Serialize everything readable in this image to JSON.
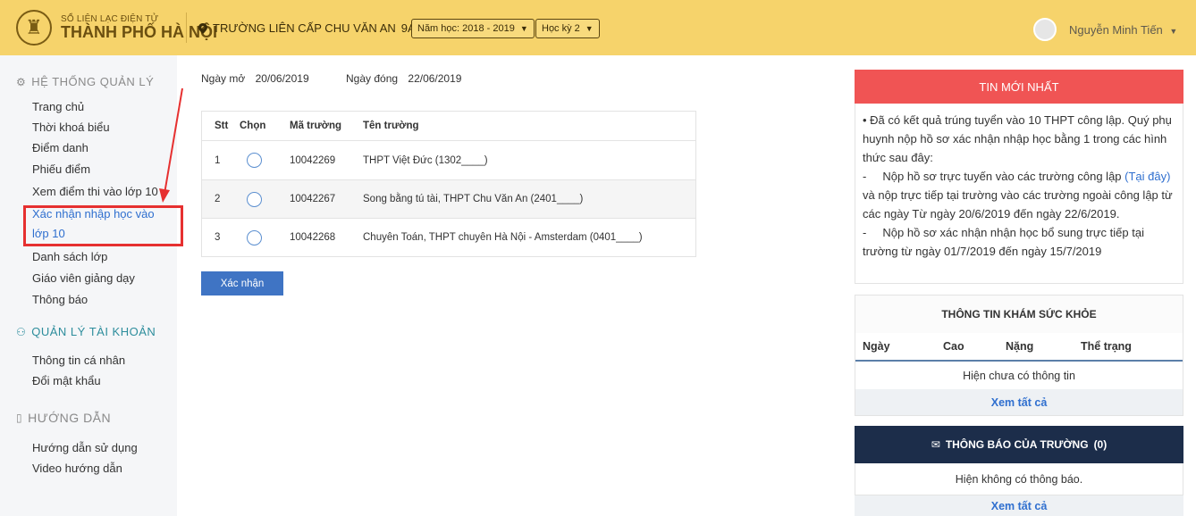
{
  "header": {
    "logo_small": "SỔ LIÊN LẠC ĐIỆN TỬ",
    "logo_big": "THÀNH PHỐ HÀ NỘI",
    "school": "TRƯỜNG LIÊN CẤP CHU VĂN AN",
    "class": "9A",
    "year_select": "Năm học: 2018 - 2019",
    "term_select": "Học kỳ 2",
    "user_name": "Nguyễn Minh Tiến"
  },
  "sidebar": {
    "section1": "HỆ THỐNG QUẢN LÝ",
    "items1": [
      "Trang chủ",
      "Thời khoá biểu",
      "Điểm danh",
      "Phiếu điểm",
      "Xem điểm thi vào lớp 10",
      "Xác nhận nhập học vào",
      "lớp 10",
      "Danh sách lớp",
      "Giáo viên giảng dạy",
      "Thông báo"
    ],
    "section2": "QUẢN LÝ TÀI KHOẢN",
    "items2": [
      "Thông tin cá nhân",
      "Đổi mật khẩu"
    ],
    "section3": "HƯỚNG DẪN",
    "items3": [
      "Hướng dẫn sử dụng",
      "Video hướng dẫn"
    ]
  },
  "main": {
    "open_label": "Ngày mở",
    "open_date": "20/06/2019",
    "close_label": "Ngày đóng",
    "close_date": "22/06/2019",
    "columns": [
      "Stt",
      "Chọn",
      "Mã trường",
      "Tên trường"
    ],
    "rows": [
      {
        "stt": "1",
        "code": "10042269",
        "name": "THPT Việt Đức (1302____)"
      },
      {
        "stt": "2",
        "code": "10042267",
        "name": "Song bằng tú tài, THPT Chu Văn An (2401____)"
      },
      {
        "stt": "3",
        "code": "10042268",
        "name": "Chuyên Toán, THPT chuyên Hà Nội - Amsterdam (0401____)"
      }
    ],
    "confirm_button": "Xác nhận"
  },
  "right": {
    "news_title": "TIN MỚI NHẤT",
    "news_p1": "• Đã có kết quả trúng tuyển vào 10 THPT công lập. Quý phụ huynh nộp hồ sơ xác nhận nhập học bằng 1 trong các hình thức sau đây:",
    "news_p2a": "-     Nộp hồ sơ trực tuyến vào các trường công lập ",
    "news_link": "(Tại đây)",
    "news_p2b": " và nộp trực tiếp tại trường vào các trường ngoài công lập từ các ngày Từ ngày 20/6/2019 đến ngày 22/6/2019.",
    "news_p3": "-     Nộp hồ sơ xác nhận nhận học bổ sung trực tiếp tại trường từ ngày 01/7/2019 đến ngày 15/7/2019",
    "health_title": "THÔNG TIN KHÁM SỨC KHỎE",
    "health_cols": [
      "Ngày",
      "Cao",
      "Nặng",
      "Thể trạng"
    ],
    "health_empty": "Hiện chưa có thông tin",
    "see_all": "Xem tất cả",
    "notice_title": "THÔNG BÁO CỦA TRƯỜNG",
    "notice_count": "(0)",
    "notice_empty": "Hiện không có thông báo."
  }
}
